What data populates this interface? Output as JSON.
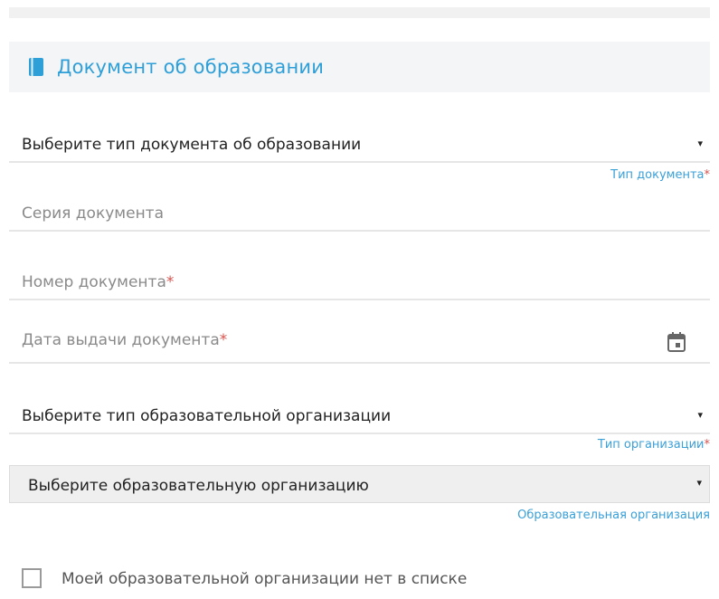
{
  "section": {
    "title": "Документ об образовании",
    "icon": "book-icon",
    "accent_color": "#2f9fd8"
  },
  "fields": {
    "doc_type": {
      "value": "Выберите тип документа об образовании",
      "helper": "Тип документа",
      "required_mark": "*"
    },
    "doc_series": {
      "placeholder": "Серия документа"
    },
    "doc_number": {
      "placeholder": "Номер документа",
      "required_mark": "*"
    },
    "issue_date": {
      "placeholder": "Дата выдачи документа",
      "required_mark": "*",
      "icon": "calendar-icon"
    },
    "org_type": {
      "value": "Выберите тип образовательной организации",
      "helper": "Тип организации",
      "required_mark": "*"
    },
    "org": {
      "value": "Выберите образовательную организацию",
      "helper": "Образовательная организация"
    }
  },
  "checkbox": {
    "label": "Моей образовательной организации нет в списке",
    "checked": false
  },
  "caret_glyph": "▾"
}
